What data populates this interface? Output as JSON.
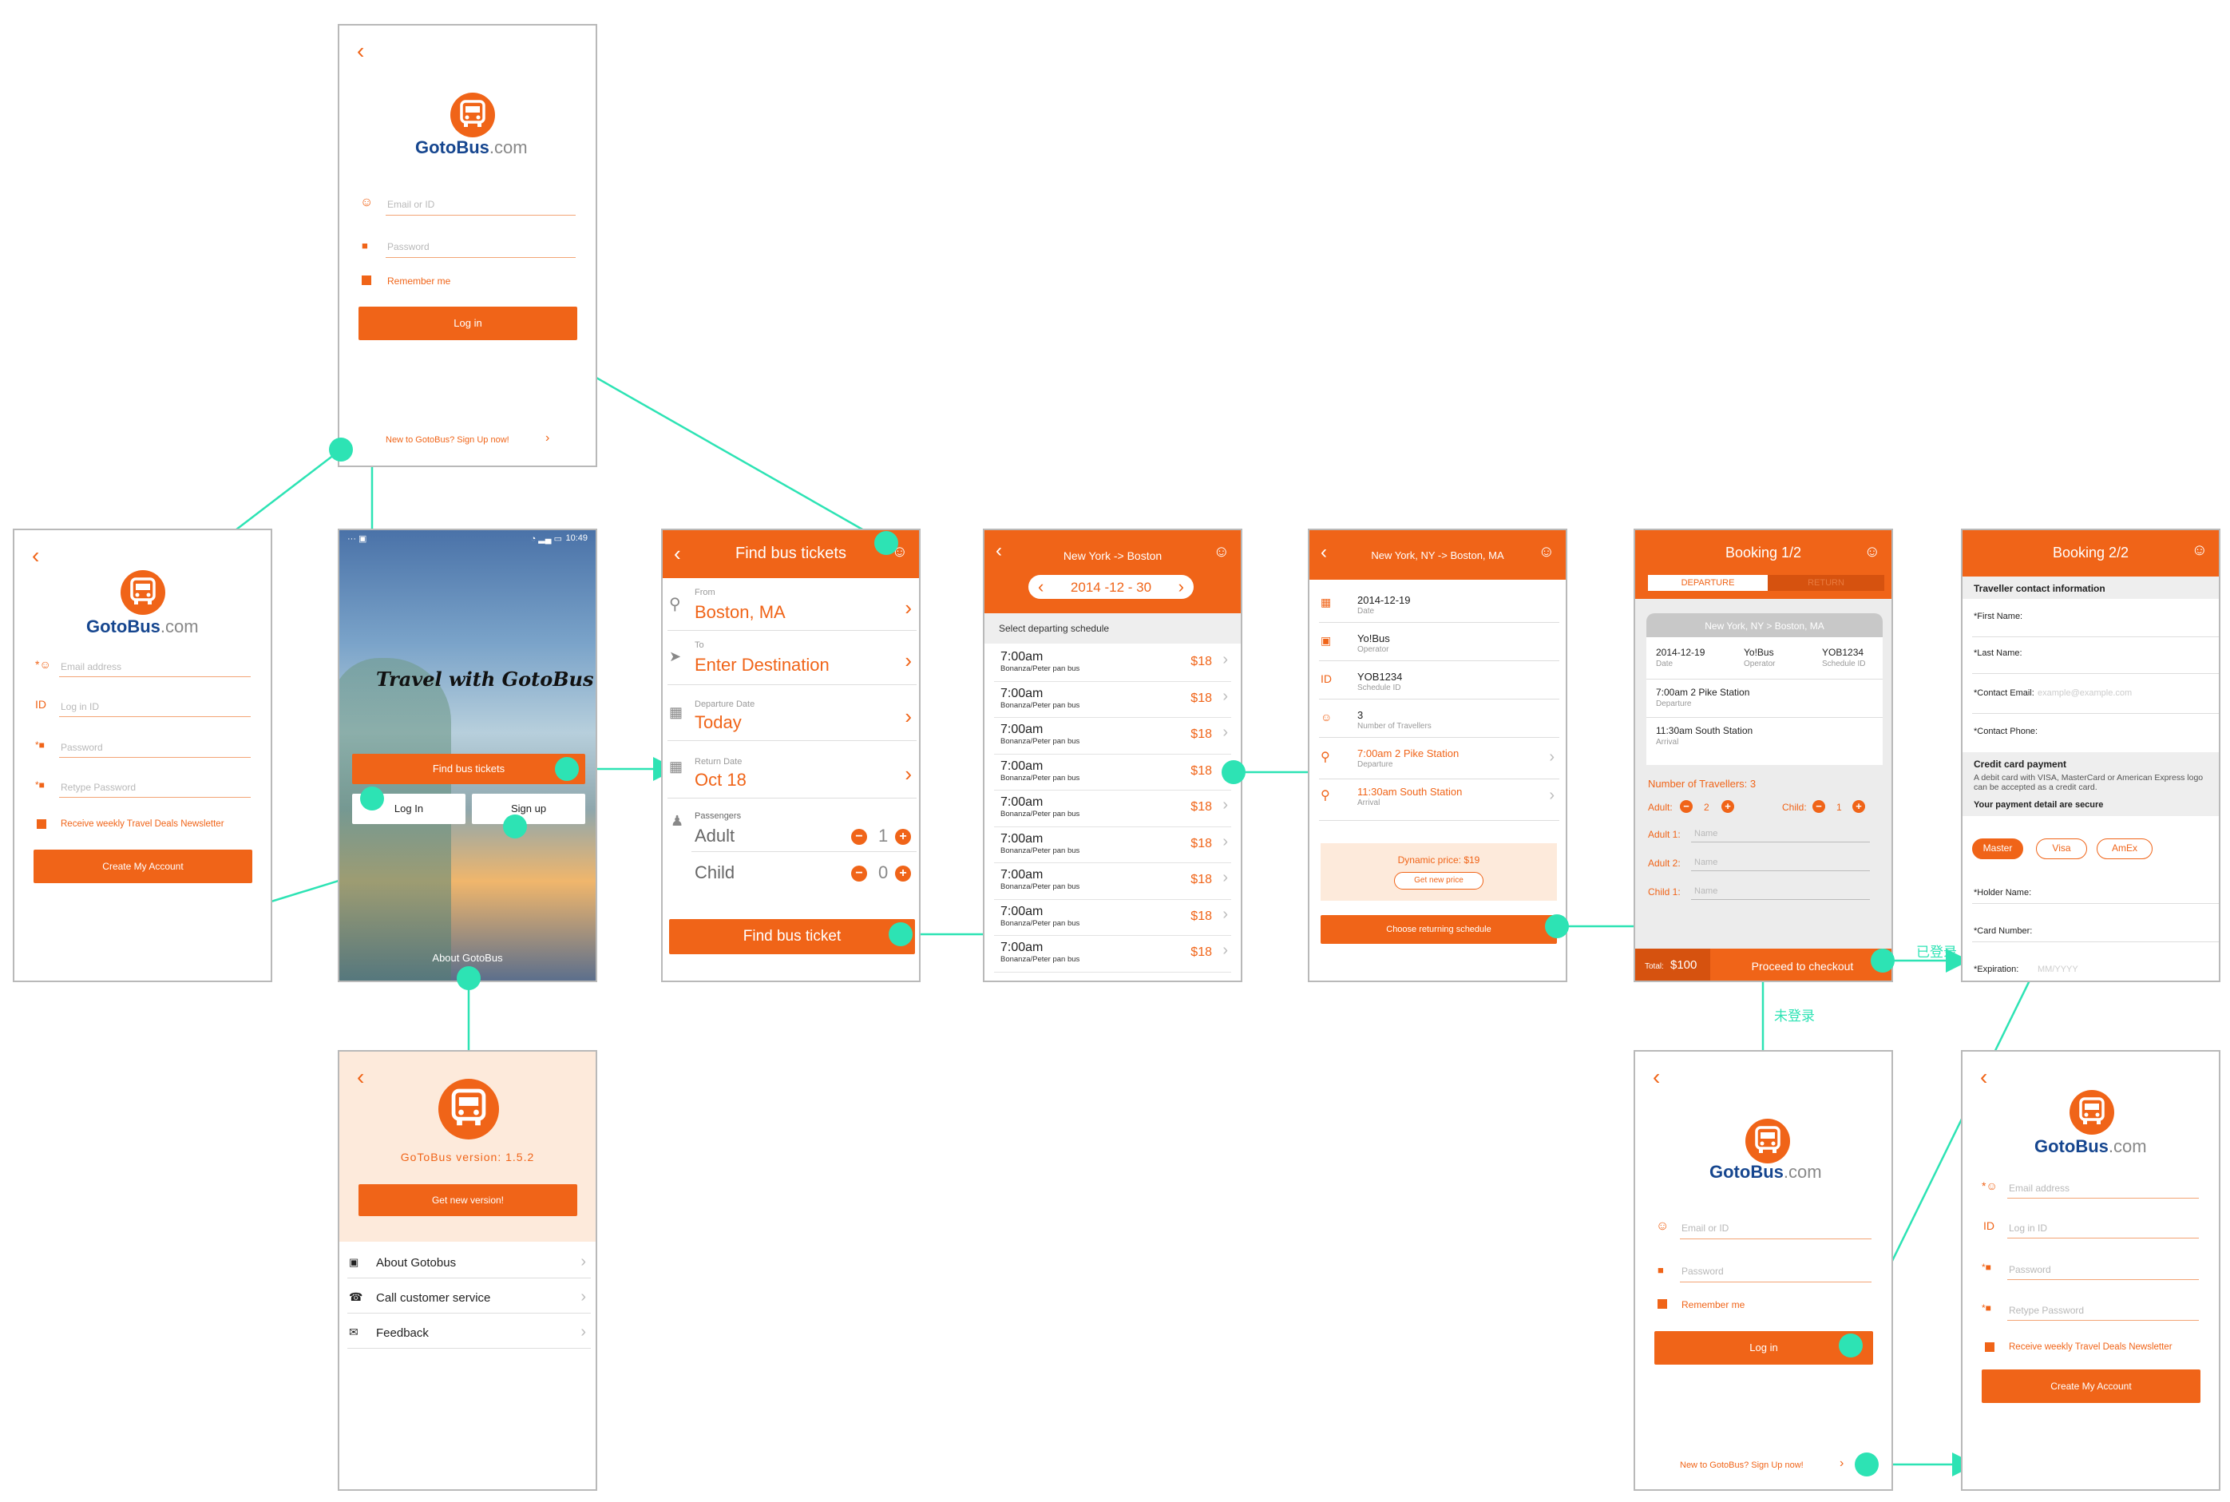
{
  "brand": {
    "name": "GotoBus",
    "com": ".com"
  },
  "login": {
    "email_ph": "Email or ID",
    "password_ph": "Password",
    "remember": "Remember me",
    "login_btn": "Log in",
    "signup_link": "New to GotoBus? Sign Up now!"
  },
  "signup": {
    "email_ph": "Email address",
    "id_label": "ID",
    "id_ph": "Log in ID",
    "password_ph": "Password",
    "retype_ph": "Retype Password",
    "newsletter": "Receive weekly Travel Deals Newsletter",
    "create_btn": "Create My Account"
  },
  "splash": {
    "time": "10:49",
    "tagline": "Travel with GotoBus",
    "find_btn": "Find bus tickets",
    "login_btn": "Log In",
    "signup_btn": "Sign up",
    "about": "About GotoBus"
  },
  "about": {
    "version": "GoToBus version: 1.5.2",
    "get_new": "Get new version!",
    "items": [
      "About Gotobus",
      "Call customer service",
      "Feedback"
    ]
  },
  "find": {
    "title": "Find bus tickets",
    "from_label": "From",
    "from_value": "Boston, MA",
    "to_label": "To",
    "to_value": "Enter Destination",
    "dep_label": "Departure Date",
    "dep_value": "Today",
    "ret_label": "Return Date",
    "ret_value": "Oct 18",
    "passengers_label": "Passengers",
    "adult_label": "Adult",
    "adult_count": "1",
    "child_label": "Child",
    "child_count": "0",
    "find_btn": "Find bus ticket"
  },
  "schedule": {
    "title": "New York -> Boston",
    "date": "2014 -12 - 30",
    "subtitle": "Select departing schedule",
    "rows": [
      {
        "time": "7:00am",
        "op": "Bonanza/Peter pan bus",
        "price": "$18"
      },
      {
        "time": "7:00am",
        "op": "Bonanza/Peter pan bus",
        "price": "$18"
      },
      {
        "time": "7:00am",
        "op": "Bonanza/Peter pan bus",
        "price": "$18"
      },
      {
        "time": "7:00am",
        "op": "Bonanza/Peter pan bus",
        "price": "$18"
      },
      {
        "time": "7:00am",
        "op": "Bonanza/Peter pan bus",
        "price": "$18"
      },
      {
        "time": "7:00am",
        "op": "Bonanza/Peter pan bus",
        "price": "$18"
      },
      {
        "time": "7:00am",
        "op": "Bonanza/Peter pan bus",
        "price": "$18"
      },
      {
        "time": "7:00am",
        "op": "Bonanza/Peter pan bus",
        "price": "$18"
      },
      {
        "time": "7:00am",
        "op": "Bonanza/Peter pan bus",
        "price": "$18"
      }
    ]
  },
  "detail": {
    "title": "New York, NY -> Boston, MA",
    "date_val": "2014-12-19",
    "date_lbl": "Date",
    "op_val": "Yo!Bus",
    "op_lbl": "Operator",
    "id_icon": "ID",
    "id_val": "YOB1234",
    "id_lbl": "Schedule ID",
    "trav_val": "3",
    "trav_lbl": "Number of Travellers",
    "dep_val": "7:00am 2 Pike Station",
    "dep_lbl": "Departure",
    "arr_val": "11:30am South Station",
    "arr_lbl": "Arrival",
    "dyn_price": "Dynamic price: $19",
    "get_new_price": "Get new price",
    "choose_btn": "Choose returning schedule"
  },
  "booking1": {
    "title": "Booking 1/2",
    "tab_dep": "DEPARTURE",
    "tab_ret": "RETURN",
    "route": "New York, NY > Boston, MA",
    "date_val": "2014-12-19",
    "date_lbl": "Date",
    "op_val": "Yo!Bus",
    "op_lbl": "Operator",
    "sid_val": "YOB1234",
    "sid_lbl": "Schedule ID",
    "dep_val": "7:00am 2 Pike Station",
    "dep_lbl": "Departure",
    "arr_val": "11:30am South Station",
    "arr_lbl": "Arrival",
    "num_trav": "Number of Travellers: 3",
    "adult_lbl": "Adult:",
    "adult_n": "2",
    "child_lbl": "Child:",
    "child_n": "1",
    "adult1": "Adult 1:",
    "adult2": "Adult 2:",
    "child1": "Child 1:",
    "name_ph": "Name",
    "total_lbl": "Total:",
    "total_val": "$100",
    "checkout": "Proceed to checkout"
  },
  "booking2": {
    "title": "Booking 2/2",
    "contact_header": "Traveller contact information",
    "first_name": "*First Name:",
    "last_name": "*Last Name:",
    "email": "*Contact Email:",
    "email_ph": "example@example.com",
    "phone": "*Contact Phone:",
    "cc_header": "Credit card payment",
    "cc_note": "A debit card with VISA, MasterCard or American Express logo can be accepted as a credit card.",
    "secure": "Your payment detail are secure",
    "cards": [
      "Master",
      "Visa",
      "AmEx"
    ],
    "holder": "*Holder Name:",
    "card_no": "*Card Number:",
    "expiry": "*Expiration:",
    "expiry_ph": "MM/YYYY"
  },
  "flow_labels": {
    "logged_in": "已登录",
    "not_logged_in": "未登录"
  },
  "colors": {
    "accent": "#f06418",
    "flow": "#2de3b4",
    "brand_blue": "#16468f"
  }
}
